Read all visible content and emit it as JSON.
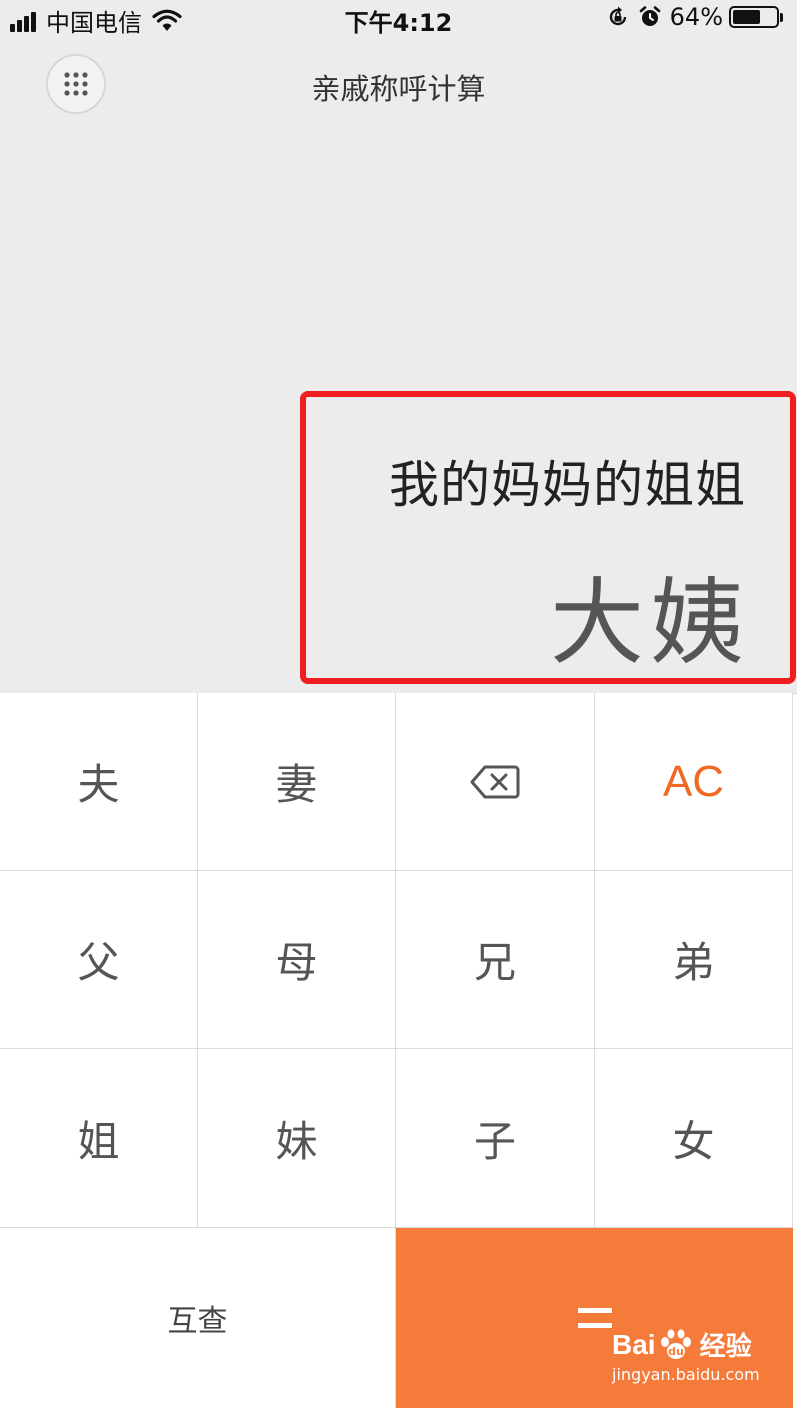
{
  "status_bar": {
    "carrier": "中国电信",
    "time": "下午4:12",
    "battery": "64%",
    "battery_level": 0.64
  },
  "header": {
    "title": "亲戚称呼计算"
  },
  "display": {
    "expression": "我的妈妈的姐姐",
    "result": "大姨"
  },
  "keypad": {
    "row1": [
      "夫",
      "妻",
      "backspace",
      "AC"
    ],
    "row2": [
      "父",
      "母",
      "兄",
      "弟"
    ],
    "row3": [
      "姐",
      "妹",
      "子",
      "女"
    ],
    "k_husband": "夫",
    "k_wife": "妻",
    "k_ac": "AC",
    "k_father": "父",
    "k_mother": "母",
    "k_elder_brother": "兄",
    "k_younger_brother": "弟",
    "k_elder_sister": "姐",
    "k_younger_sister": "妹",
    "k_son": "子",
    "k_daughter": "女",
    "k_swap": "互查",
    "accent_color": "#f47b3a",
    "ac_color": "#f06a26"
  },
  "watermark": {
    "brand": "Bai",
    "brand_end": "du",
    "brand_cn": "经验",
    "url": "jingyan.baidu.com"
  }
}
